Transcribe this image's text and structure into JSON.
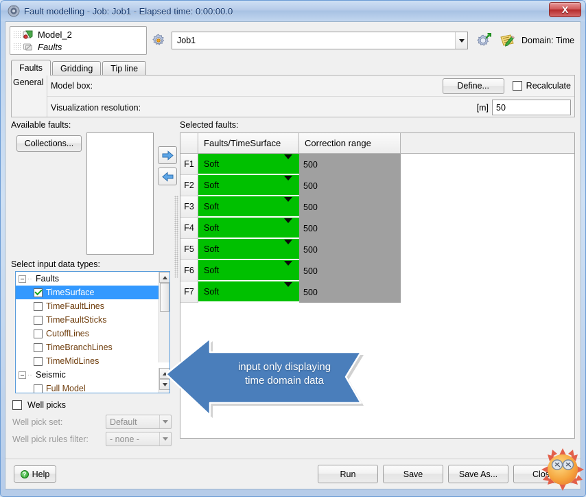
{
  "window": {
    "title": "Fault modelling - Job: Job1 - Elapsed time: 0:00:00.0",
    "close_label": "X",
    "title_icon": "app-icon"
  },
  "header": {
    "model_name": "Model_2",
    "model_sub": "Faults",
    "job_value": "Job1",
    "domain_label": "Domain:  Time",
    "settings_icon": "gear-icon",
    "export_icon": "gear-export-icon",
    "notes_icon": "edit-notes-icon"
  },
  "tabs": [
    {
      "label": "Faults",
      "active": true
    },
    {
      "label": "Gridding",
      "active": false
    },
    {
      "label": "Tip line",
      "active": false
    }
  ],
  "general": {
    "group_label": "General",
    "model_box_label": "Model box:",
    "define_button": "Define...",
    "recalculate_label": "Recalculate",
    "recalculate_checked": false,
    "resolution_label": "Visualization resolution:",
    "resolution_unit": "[m]",
    "resolution_value": "50"
  },
  "left": {
    "available_label": "Available faults:",
    "collections_button": "Collections...",
    "available_items": [],
    "add_arrow_icon": "arrow-right-icon",
    "remove_arrow_icon": "arrow-left-icon",
    "input_types_label": "Select input data types:",
    "tree": [
      {
        "label": "Faults",
        "type": "group",
        "expanded": true
      },
      {
        "label": "TimeSurface",
        "type": "leaf",
        "checked": true,
        "selected": true
      },
      {
        "label": "TimeFaultLines",
        "type": "leaf",
        "checked": false,
        "selected": false
      },
      {
        "label": "TimeFaultSticks",
        "type": "leaf",
        "checked": false,
        "selected": false
      },
      {
        "label": "CutoffLines",
        "type": "leaf",
        "checked": false,
        "selected": false
      },
      {
        "label": "TimeBranchLines",
        "type": "leaf",
        "checked": false,
        "selected": false
      },
      {
        "label": "TimeMidLines",
        "type": "leaf",
        "checked": false,
        "selected": false
      },
      {
        "label": "Seismic",
        "type": "group",
        "expanded": true
      },
      {
        "label": "Full Model",
        "type": "leaf",
        "checked": false,
        "selected": false
      }
    ],
    "well_picks_label": "Well picks",
    "well_picks_checked": false,
    "well_pick_set_label": "Well pick set:",
    "well_pick_set_value": "Default",
    "well_pick_rules_label": "Well pick rules filter:",
    "well_pick_rules_value": "- none -"
  },
  "right": {
    "selected_label": "Selected faults:",
    "columns": [
      "",
      "Faults/TimeSurface",
      "Correction range"
    ],
    "rows": [
      {
        "index": "F1",
        "type": "Soft",
        "range": "500"
      },
      {
        "index": "F2",
        "type": "Soft",
        "range": "500"
      },
      {
        "index": "F3",
        "type": "Soft",
        "range": "500"
      },
      {
        "index": "F4",
        "type": "Soft",
        "range": "500"
      },
      {
        "index": "F5",
        "type": "Soft",
        "range": "500"
      },
      {
        "index": "F6",
        "type": "Soft",
        "range": "500"
      },
      {
        "index": "F7",
        "type": "Soft",
        "range": "500"
      }
    ]
  },
  "callout": {
    "text": "input only displaying\ntime domain data",
    "fill": "#4a7ebb"
  },
  "footer": {
    "help_label": "Help",
    "buttons": [
      "Run",
      "Save",
      "Save As...",
      "Close"
    ]
  },
  "colors": {
    "title_text": "#15376b",
    "soft_green": "#00c000",
    "range_grey": "#a0a0a0",
    "tree_select": "#3399ff",
    "tree_item_text": "#6e3c0b",
    "callout_blue": "#4a7ebb",
    "close_red": "#b52b2b"
  }
}
